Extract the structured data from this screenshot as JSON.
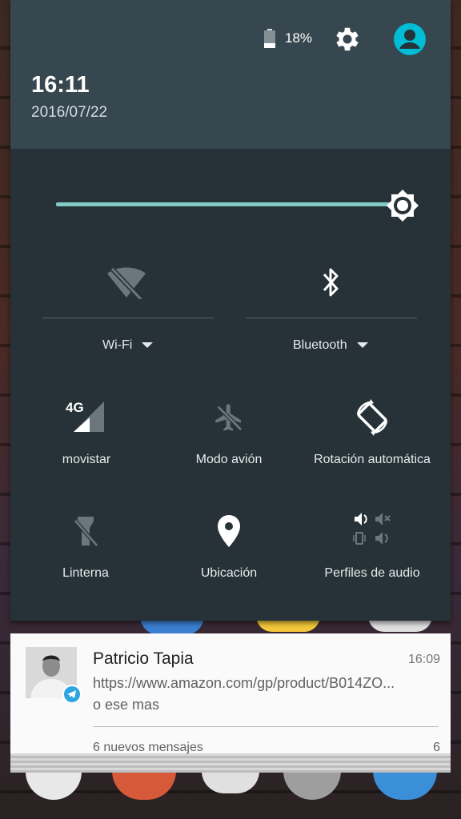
{
  "status": {
    "battery_percent": "18%",
    "battery_level": 0.18
  },
  "header": {
    "time": "16:11",
    "date": "2016/07/22"
  },
  "brightness": {
    "level": 1.0
  },
  "tiles": {
    "wifi": {
      "label": "Wi-Fi",
      "icon": "wifi-off-icon"
    },
    "bluetooth": {
      "label": "Bluetooth",
      "icon": "bluetooth-icon"
    },
    "mobile": {
      "label": "movistar",
      "badge": "4G",
      "icon": "signal-4g-icon"
    },
    "airplane": {
      "label": "Modo avión",
      "icon": "airplane-icon"
    },
    "rotation": {
      "label": "Rotación automática",
      "icon": "auto-rotate-icon"
    },
    "flashlight": {
      "label": "Linterna",
      "icon": "flashlight-off-icon"
    },
    "location": {
      "label": "Ubicación",
      "icon": "location-pin-icon"
    },
    "audio": {
      "label": "Perfiles de audio",
      "icon": "audio-profiles-icon"
    }
  },
  "notification": {
    "title": "Patricio Tapia",
    "time": "16:09",
    "line1": "https://www.amazon.com/gp/product/B014ZO...",
    "line2": "o ese mas",
    "summary": "6 nuevos mensajes",
    "count": "6",
    "app_badge_color": "#2ca5e0"
  },
  "colors": {
    "shade": "#263238",
    "header": "#37474f",
    "accent": "#80cbc4"
  }
}
